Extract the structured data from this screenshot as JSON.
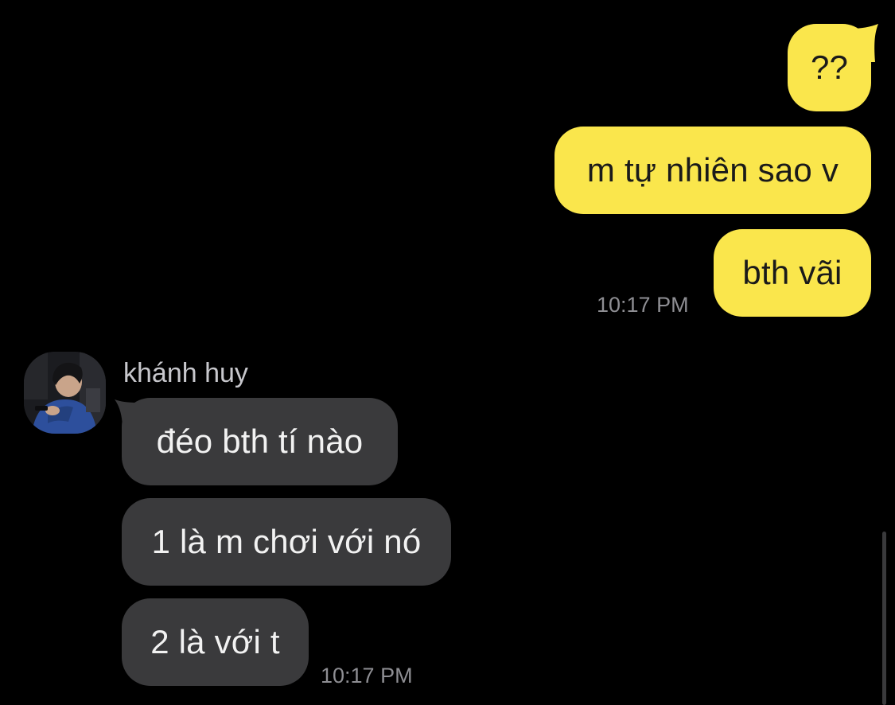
{
  "outgoing": {
    "messages": [
      {
        "text": "??"
      },
      {
        "text": "m tự nhiên sao v"
      },
      {
        "text": "bth vãi"
      }
    ],
    "timestamp": "10:17 PM"
  },
  "incoming": {
    "sender_name": "khánh huy",
    "messages": [
      {
        "text": "đéo bth tí nào"
      },
      {
        "text": "1 là m chơi với nó"
      },
      {
        "text": "2 là với t"
      }
    ],
    "timestamp": "10:17 PM"
  },
  "colors": {
    "background": "#000000",
    "outgoing_bubble": "#FAE64C",
    "incoming_bubble": "#3A3A3C",
    "timestamp": "#8E8E93",
    "sender_name": "#C7C7CC"
  },
  "icons": {
    "avatar": "user-photo-avatar"
  }
}
